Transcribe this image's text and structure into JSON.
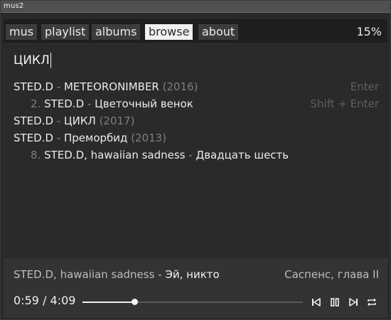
{
  "window": {
    "title": "mus2"
  },
  "nav": {
    "tabs": [
      {
        "label": "mus",
        "active": false
      },
      {
        "label": "playlist",
        "active": false
      },
      {
        "label": "albums",
        "active": false
      },
      {
        "label": "browse",
        "active": true
      },
      {
        "label": "about",
        "active": false
      }
    ],
    "zoom": "15%"
  },
  "search": {
    "value": "ЦИКЛ"
  },
  "results": [
    {
      "number": "",
      "artist": "STED.D",
      "separator": " - ",
      "title": "METEORONIMBER",
      "year": "(2016)",
      "hint": "Enter"
    },
    {
      "number": "2.",
      "artist": "STED.D",
      "separator": " - ",
      "title": "Цветочный венок",
      "year": "",
      "hint": "Shift + Enter"
    },
    {
      "number": "",
      "artist": "STED.D",
      "separator": " - ",
      "title": "ЦИКЛ",
      "year": "(2017)",
      "hint": ""
    },
    {
      "number": "",
      "artist": "STED.D",
      "separator": " - ",
      "title": "Преморбид",
      "year": "(2013)",
      "hint": ""
    },
    {
      "number": "8.",
      "artist": "STED.D, hawaiian sadness",
      "separator": " - ",
      "title": "Двадцать шесть",
      "year": "",
      "hint": ""
    }
  ],
  "player": {
    "artist": "STED.D, hawaiian sadness",
    "separator": " - ",
    "song": "Эй, никто",
    "album": "Саспенс, глава II",
    "elapsed": "0:59",
    "time_separator": " / ",
    "duration": "4:09",
    "progress": 0.237,
    "icons": [
      "skip-previous-icon",
      "pause-icon",
      "skip-next-icon",
      "repeat-icon"
    ]
  },
  "colors": {
    "background": "#1e1e1e",
    "panel": "#2a2a2a",
    "player": "#333333",
    "tab": "#3c3c3c",
    "tab_active": "#f0f0f0",
    "text": "#ececec",
    "dim": "#7e7e7e",
    "hint": "#5f5f5f"
  }
}
